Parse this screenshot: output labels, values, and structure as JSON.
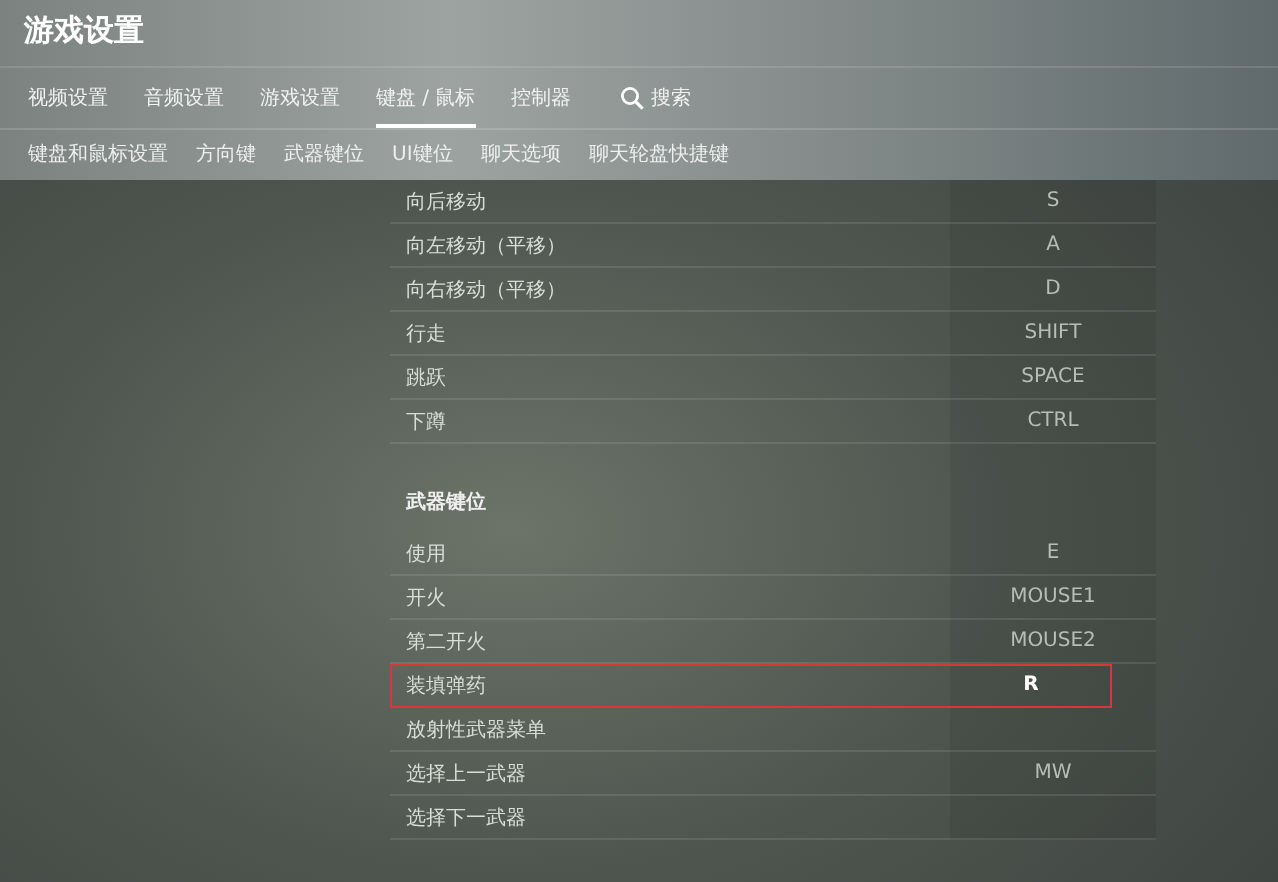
{
  "window": {
    "title": "游戏设置"
  },
  "tabs": [
    {
      "label": "视频设置",
      "selected": false
    },
    {
      "label": "音频设置",
      "selected": false
    },
    {
      "label": "游戏设置",
      "selected": false
    },
    {
      "label": "键盘 / 鼠标",
      "selected": true
    },
    {
      "label": "控制器",
      "selected": false
    }
  ],
  "search": {
    "label": "搜索"
  },
  "subtabs": [
    "键盘和鼠标设置",
    "方向键",
    "武器键位",
    "UI键位",
    "聊天选项",
    "聊天轮盘快捷键"
  ],
  "sections": [
    {
      "rows": [
        {
          "action": "向后移动",
          "key": "S",
          "highlighted": false
        },
        {
          "action": "向左移动（平移）",
          "key": "A",
          "highlighted": false
        },
        {
          "action": "向右移动（平移）",
          "key": "D",
          "highlighted": false
        },
        {
          "action": "行走",
          "key": "SHIFT",
          "highlighted": false
        },
        {
          "action": "跳跃",
          "key": "SPACE",
          "highlighted": false
        },
        {
          "action": "下蹲",
          "key": "CTRL",
          "highlighted": false
        }
      ]
    },
    {
      "title": "武器键位",
      "rows": [
        {
          "action": "使用",
          "key": "E",
          "highlighted": false
        },
        {
          "action": "开火",
          "key": "MOUSE1",
          "highlighted": false
        },
        {
          "action": "第二开火",
          "key": "MOUSE2",
          "highlighted": false
        },
        {
          "action": "装填弹药",
          "key": "R",
          "highlighted": true
        },
        {
          "action": "放射性武器菜单",
          "highlighted": false
        },
        {
          "action": "选择上一武器",
          "key": "MW",
          "highlighted": false
        },
        {
          "action": "选择下一武器",
          "highlighted": false
        }
      ]
    }
  ]
}
